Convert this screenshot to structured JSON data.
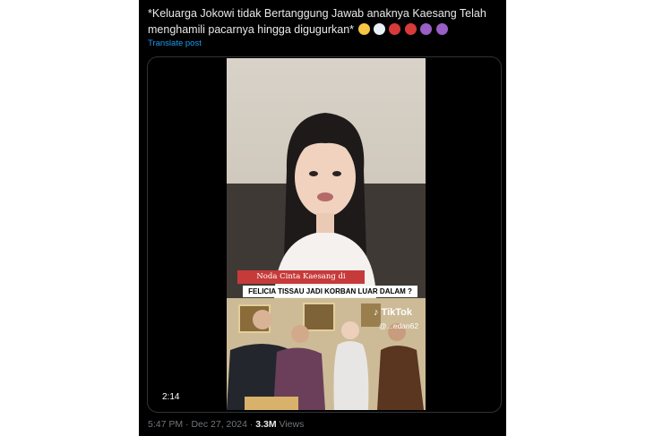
{
  "post": {
    "text": "*Keluarga Jokowi tidak Bertanggung Jawab anaknya Kaesang Telah menghamili pacarnya hingga digugurkan*",
    "translate_label": "Translate post",
    "emojis": [
      "thinking-face",
      "speech-balloon",
      "angry-face",
      "angry-face",
      "angry-devil",
      "angry-devil"
    ]
  },
  "video": {
    "caption_title": "Noda Cinta Kaesang di Singapura",
    "caption_subtitle": "FELICIA TISSAU JADI KORBAN LUAR DALAM ?",
    "tiktok_label": "TikTok",
    "tiktok_handle": "@...edan62",
    "duration": "2:14"
  },
  "meta": {
    "time": "5:47 PM",
    "separator": "·",
    "date": "Dec 27, 2024",
    "views_count": "3.3M",
    "views_label": "Views"
  }
}
